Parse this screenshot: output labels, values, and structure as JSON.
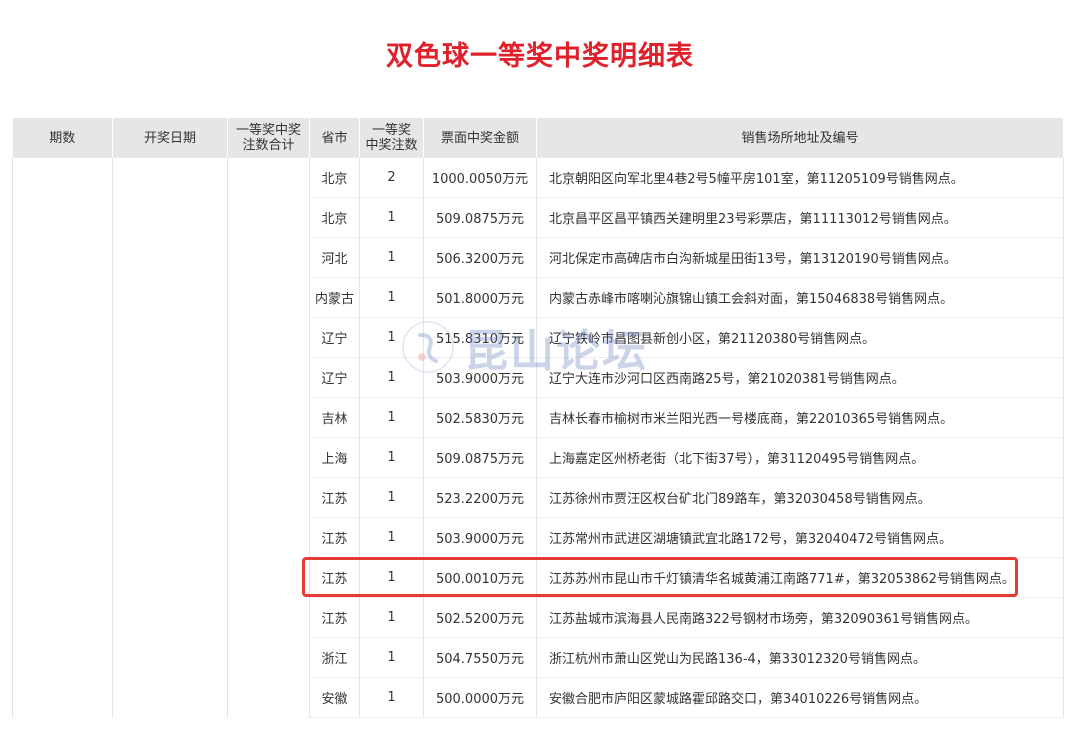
{
  "title": "双色球一等奖中奖明细表",
  "headers": {
    "period": "期数",
    "date": "开奖日期",
    "total_line1": "一等奖中奖",
    "total_line2": "注数合计",
    "province": "省市",
    "count_line1": "一等奖",
    "count_line2": "中奖注数",
    "amount": "票面中奖金额",
    "address": "销售场所地址及编号"
  },
  "rows": [
    {
      "province": "北京",
      "count": "2",
      "amount": "1000.0050万元",
      "address": "北京朝阳区向军北里4巷2号5幢平房101室，第11205109号销售网点。"
    },
    {
      "province": "北京",
      "count": "1",
      "amount": "509.0875万元",
      "address": "北京昌平区昌平镇西关建明里23号彩票店，第11113012号销售网点。"
    },
    {
      "province": "河北",
      "count": "1",
      "amount": "506.3200万元",
      "address": "河北保定市高碑店市白沟新城星田街13号，第13120190号销售网点。"
    },
    {
      "province": "内蒙古",
      "count": "1",
      "amount": "501.8000万元",
      "address": "内蒙古赤峰市喀喇沁旗锦山镇工会斜对面，第15046838号销售网点。"
    },
    {
      "province": "辽宁",
      "count": "1",
      "amount": "515.8310万元",
      "address": "辽宁铁岭市昌图县新创小区，第21120380号销售网点。"
    },
    {
      "province": "辽宁",
      "count": "1",
      "amount": "503.9000万元",
      "address": "辽宁大连市沙河口区西南路25号，第21020381号销售网点。"
    },
    {
      "province": "吉林",
      "count": "1",
      "amount": "502.5830万元",
      "address": "吉林长春市榆树市米兰阳光西一号楼底商，第22010365号销售网点。"
    },
    {
      "province": "上海",
      "count": "1",
      "amount": "509.0875万元",
      "address": "上海嘉定区州桥老街（北下街37号），第31120495号销售网点。"
    },
    {
      "province": "江苏",
      "count": "1",
      "amount": "523.2200万元",
      "address": "江苏徐州市贾汪区权台矿北门89路车，第32030458号销售网点。"
    },
    {
      "province": "江苏",
      "count": "1",
      "amount": "503.9000万元",
      "address": "江苏常州市武进区湖塘镇武宜北路172号，第32040472号销售网点。"
    },
    {
      "province": "江苏",
      "count": "1",
      "amount": "500.0010万元",
      "address": "江苏苏州市昆山市千灯镇清华名城黄浦江南路771#，第32053862号销售网点。"
    },
    {
      "province": "江苏",
      "count": "1",
      "amount": "502.5200万元",
      "address": "江苏盐城市滨海县人民南路322号钢材市场旁，第32090361号销售网点。"
    },
    {
      "province": "浙江",
      "count": "1",
      "amount": "504.7550万元",
      "address": "浙江杭州市萧山区党山为民路136-4，第33012320号销售网点。"
    },
    {
      "province": "安徽",
      "count": "1",
      "amount": "500.0000万元",
      "address": "安徽合肥市庐阳区蒙城路霍邱路交口，第34010226号销售网点。"
    }
  ],
  "watermark": {
    "text": "昆山论坛",
    "icon": "seal-logo-icon"
  },
  "colors": {
    "title": "#e0202a",
    "highlight": "#e53a35",
    "header_bg": "#e6e6e6"
  }
}
